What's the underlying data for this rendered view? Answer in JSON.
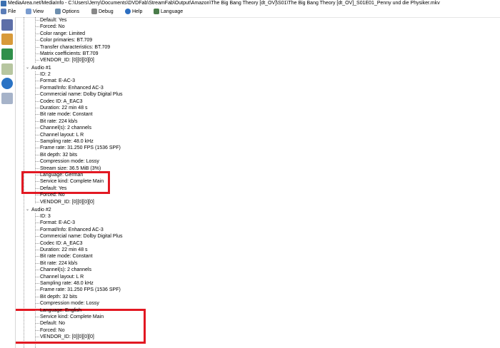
{
  "window": {
    "title": "MediaArea.net/MediaInfo - C:\\Users\\Jerry\\Documents\\DVDFab\\StreamFab\\Output\\Amazon\\The Big Bang Theory [dt_OV]\\S01\\The Big Bang Theory [dt_OV]_S01E01_Penny und die Physiker.mkv"
  },
  "menu": {
    "file": "File",
    "view": "View",
    "options": "Options",
    "debug": "Debug",
    "help": "Help",
    "language": "Language"
  },
  "sidebar": {
    "icons": [
      "open-file-icon",
      "open-folder-icon",
      "export-icon",
      "options-icon",
      "about-icon",
      "copy-icon"
    ]
  },
  "top_rows": [
    "Default: Yes",
    "Forced: No",
    "Color range: Limited",
    "Color primaries: BT.709",
    "Transfer characteristics: BT.709",
    "Matrix coefficients: BT.709",
    "VENDOR_ID: [0][0][0][0]"
  ],
  "audio1": {
    "title": "Audio #1",
    "rows": [
      "ID: 2",
      "Format: E-AC-3",
      "Format/Info: Enhanced AC-3",
      "Commercial name: Dolby Digital Plus",
      "Codec ID: A_EAC3",
      "Duration: 22 min 48 s",
      "Bit rate mode: Constant",
      "Bit rate: 224 kb/s",
      "Channel(s): 2 channels",
      "Channel layout: L R",
      "Sampling rate: 48.0 kHz",
      "Frame rate: 31.250 FPS (1536 SPF)",
      "Bit depth: 32 bits",
      "Compression mode: Lossy",
      "Stream size: 36.5 MiB (3%)",
      "Language: German",
      "Service kind: Complete Main",
      "Default: Yes",
      "Forced: No",
      "VENDOR_ID: [0][0][0][0]"
    ]
  },
  "audio2": {
    "title": "Audio #2",
    "rows": [
      "ID: 3",
      "Format: E-AC-3",
      "Format/Info: Enhanced AC-3",
      "Commercial name: Dolby Digital Plus",
      "Codec ID: A_EAC3",
      "Duration: 22 min 48 s",
      "Bit rate mode: Constant",
      "Bit rate: 224 kb/s",
      "Channel(s): 2 channels",
      "Channel layout: L R",
      "Sampling rate: 48.0 kHz",
      "Frame rate: 31.250 FPS (1536 SPF)",
      "Bit depth: 32 bits",
      "Compression mode: Lossy",
      "Language: English",
      "Service kind: Complete Main",
      "Default: No",
      "Forced: No",
      "VENDOR_ID: [0][0][0][0]"
    ]
  },
  "colors": {
    "highlight_box": "#e21822",
    "tree_lines": "#9a9a9a"
  }
}
